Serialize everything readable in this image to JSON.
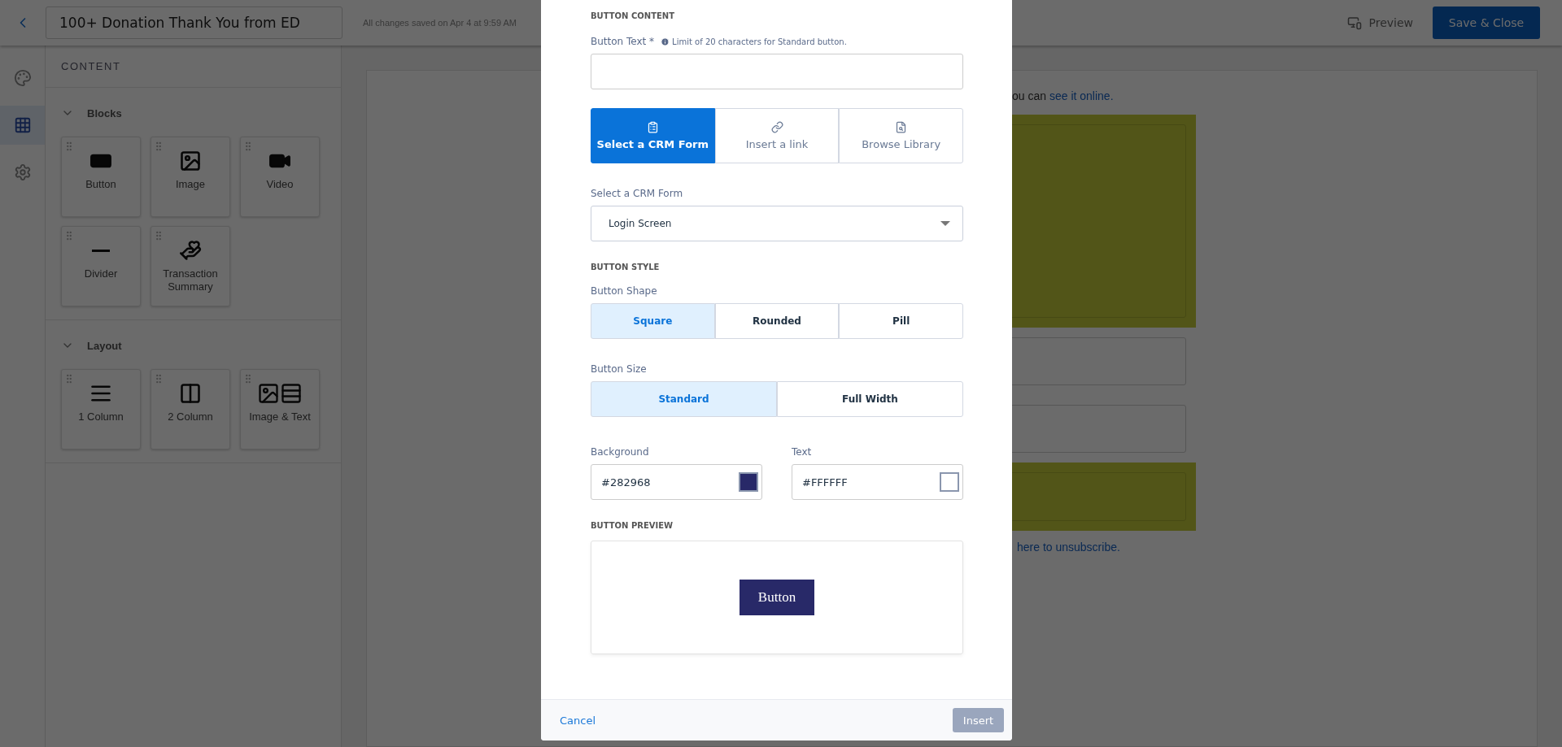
{
  "header": {
    "title": "100+ Donation Thank You from ED",
    "save_status": "All changes saved on Apr 4 at 9:59 AM",
    "preview": "Preview",
    "save_close": "Save & Close"
  },
  "rail": [
    {
      "kind": "palette",
      "selected": false
    },
    {
      "kind": "grid",
      "selected": true
    },
    {
      "kind": "settings",
      "selected": false
    }
  ],
  "content_panel": {
    "heading": "CONTENT",
    "sections": [
      {
        "title": "Blocks",
        "expanded": true,
        "tiles": [
          {
            "kind": "button",
            "label": "Button"
          },
          {
            "kind": "image",
            "label": "Image"
          },
          {
            "kind": "video",
            "label": "Video"
          },
          {
            "kind": "divider",
            "label": "Divider"
          },
          {
            "kind": "transaction",
            "label": "Transaction Summary"
          }
        ]
      },
      {
        "title": "Layout",
        "expanded": true,
        "tiles": [
          {
            "kind": "one_column",
            "label": "1 Column"
          },
          {
            "kind": "two_column",
            "label": "2 Column"
          },
          {
            "kind": "image_text",
            "label": "Image & Text"
          }
        ]
      }
    ]
  },
  "email": {
    "intro": "ou can",
    "online_link": "see it online.",
    "unsubscribe_link": "here to unsubscribe."
  },
  "modal": {
    "content_heading": "BUTTON CONTENT",
    "button_text_label": "Button Text *",
    "button_text_hint": "Limit of 20 characters for Standard button.",
    "link_types": [
      {
        "kind": "form",
        "label": "Select a CRM Form",
        "selected": true
      },
      {
        "kind": "link",
        "label": "Insert a link",
        "selected": false
      },
      {
        "kind": "library",
        "label": "Browse Library",
        "selected": false
      }
    ],
    "form_label": "Select a CRM Form",
    "form_value": "Login Screen",
    "style_heading": "BUTTON STYLE",
    "shape_label": "Button Shape",
    "shapes": [
      {
        "label": "Square",
        "selected": true
      },
      {
        "label": "Rounded",
        "selected": false
      },
      {
        "label": "Pill",
        "selected": false
      }
    ],
    "size_label": "Button Size",
    "sizes": [
      {
        "label": "Standard",
        "selected": true
      },
      {
        "label": "Full Width",
        "selected": false
      }
    ],
    "colors": [
      {
        "label": "Background",
        "value": "#282968",
        "color": "#282968"
      },
      {
        "label": "Text",
        "value": "#FFFFFF",
        "color": "#ffffff"
      }
    ],
    "preview_heading": "BUTTON PREVIEW",
    "preview_button": "Button",
    "cancel": "Cancel",
    "insert": "Insert",
    "insert_disabled": true
  }
}
